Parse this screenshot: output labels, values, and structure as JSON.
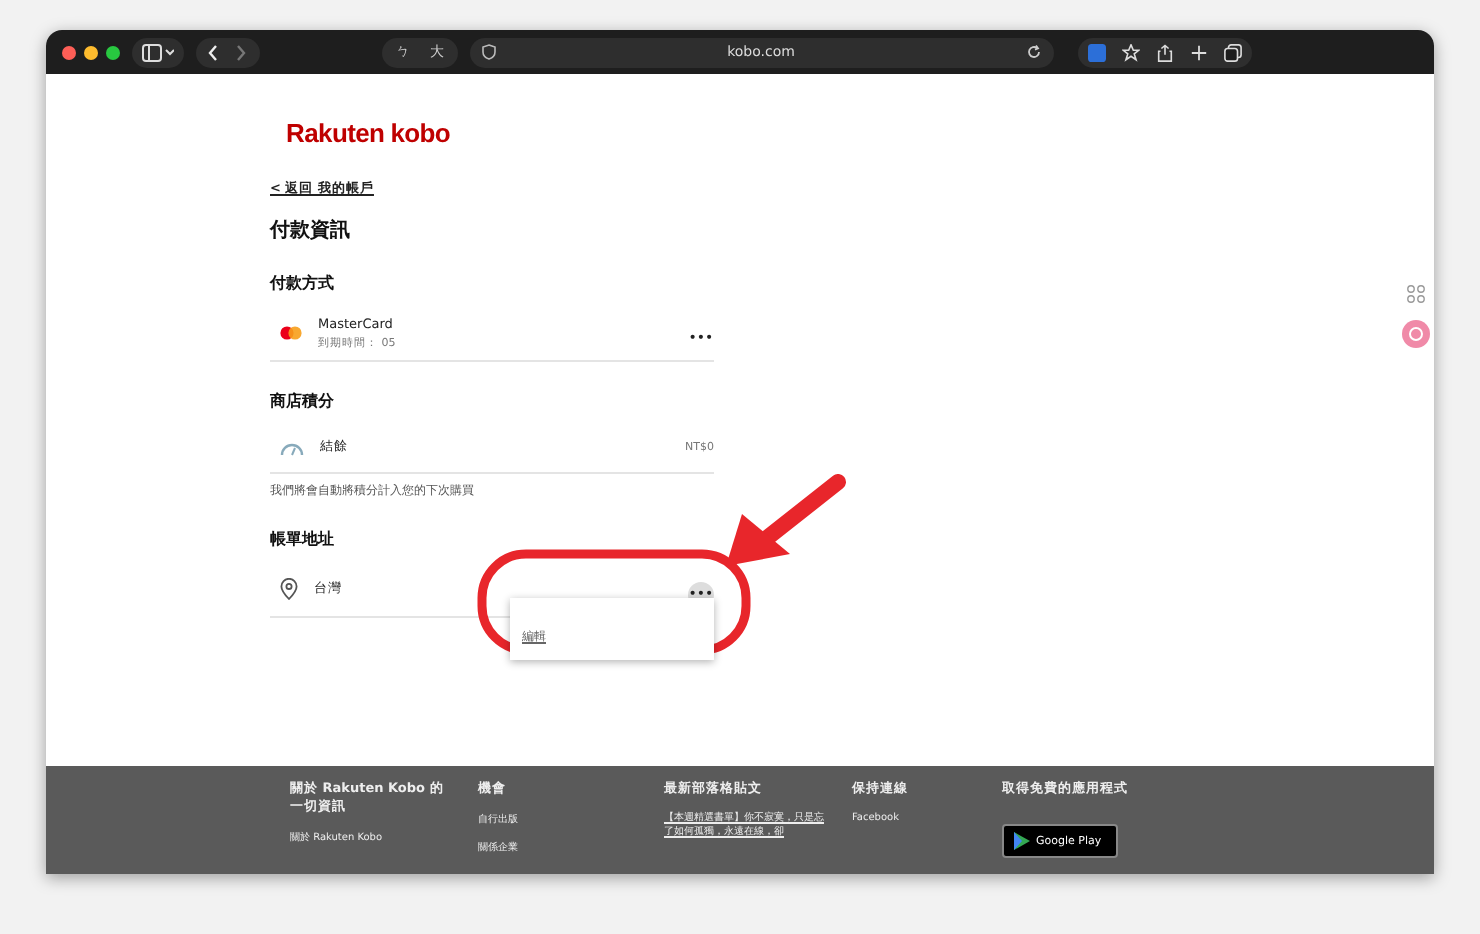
{
  "browser": {
    "url": "kobo.com",
    "tab_chars": [
      "ㄅ",
      "大"
    ]
  },
  "logo": {
    "brand": "Rakuten",
    "name": "kobo"
  },
  "back_link": {
    "arrow": "<",
    "text": "返回 我的帳戶"
  },
  "page_title": "付款資訊",
  "sections": [
    {
      "kind": "card",
      "heading": "付款方式",
      "name": "MasterCard",
      "detail": "到期時間： 05",
      "menu": "•••"
    },
    {
      "kind": "points",
      "heading": "商店積分",
      "name": "結餘",
      "amount": "NT$0",
      "note": "我們將會自動將積分計入您的下次購買"
    },
    {
      "kind": "address",
      "heading": "帳單地址",
      "name": "台灣",
      "menu": "•••",
      "menu_open": true,
      "menu_items": [
        "編輯"
      ]
    }
  ],
  "footer": {
    "columns": [
      {
        "heading": "關於 Rakuten Kobo 的一切資訊",
        "items": [
          "關於 Rakuten Kobo"
        ]
      },
      {
        "heading": "機會",
        "items": [
          "自行出版",
          "關係企業"
        ]
      },
      {
        "heading": "最新部落格貼文",
        "items": [
          "【本週精選書單】你不寂寞，只是忘了如何孤獨，永遠在線，卻"
        ]
      },
      {
        "heading": "保持連線",
        "items": [
          "Facebook"
        ]
      },
      {
        "heading": "取得免費的應用程式",
        "badge": "Google Play"
      }
    ]
  }
}
